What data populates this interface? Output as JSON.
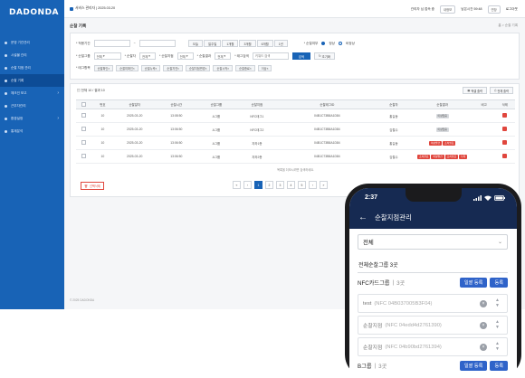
{
  "app": {
    "logo": "DADONDA"
  },
  "sidebar": {
    "items": [
      {
        "label": "운영 기관관리",
        "active": false,
        "chevron": false
      },
      {
        "label": "시설물 관리",
        "active": false,
        "chevron": false
      },
      {
        "label": "순찰 지점 관리",
        "active": false,
        "chevron": false
      },
      {
        "label": "순찰 기록",
        "active": true,
        "chevron": false
      },
      {
        "label": "체크인 보고",
        "active": false,
        "chevron": true
      },
      {
        "label": "근무자관리",
        "active": false,
        "chevron": false
      },
      {
        "label": "환경설정",
        "active": false,
        "chevron": true
      },
      {
        "label": "통계분석",
        "active": false,
        "chevron": false
      }
    ]
  },
  "topbar": {
    "site": "서비스 관리자 | 2025.03.20",
    "user": "관리자 님 접속 중",
    "user_btn": "내정보",
    "time_text": "남은시간 59:48",
    "extend": "연장",
    "logout": "로그아웃"
  },
  "page": {
    "title": "순찰 기록",
    "breadcrumb": "홈 > 순찰 기록"
  },
  "filter": {
    "date_label": "* 적용기간",
    "date_from": "",
    "date_to": "",
    "date_sep": "~",
    "quick_ranges": [
      "오늘",
      "일주일",
      "1개월",
      "3개월",
      "6개월",
      "1년"
    ],
    "radio_label": "* 순찰여부",
    "radio_opts": [
      "정상",
      "비정상"
    ],
    "sel1_label": "* 순찰그룹",
    "sel1": "전체",
    "sel2_label": "* 순찰자",
    "sel2": "전체",
    "sel3_label": "* 순찰지점",
    "sel3": "전체",
    "sel4_label": "* 순찰결과",
    "sel4": "전체",
    "search_label": "* 태그검색",
    "search_placeholder": "키워드 검색",
    "search_btn": "검색",
    "reset_btn": "초기화",
    "tags_label": "* 태그항목",
    "chips": [
      "순찰확인",
      "순찰미확인",
      "순찰누락",
      "순찰지연",
      "순찰지점변경",
      "순찰시작",
      "순찰종료",
      "이상"
    ]
  },
  "table": {
    "count_text": "전체 10 / 결과 10",
    "excel_btn": "엑셀 출력",
    "print_btn": "전체 출력",
    "headers": [
      "",
      "번호",
      "순찰일자",
      "순찰시간",
      "순찰그룹",
      "순찰지점",
      "순찰태그ID",
      "순찰자",
      "순찰결과",
      "비고",
      "삭제"
    ],
    "rows": [
      {
        "no": "10",
        "date": "2025-03-20",
        "time": "13:08:50",
        "group": "A그룹",
        "point": "NFC태그1",
        "tagid": "04B1C73B8A1D84",
        "user": "홍길동",
        "tags": [
          {
            "t": "이상없음",
            "grey": true
          }
        ]
      },
      {
        "no": "10",
        "date": "2025-03-20",
        "time": "13:06:50",
        "group": "A그룹",
        "point": "NFC태그2",
        "tagid": "04B1C73B8A1D84",
        "user": "김철수",
        "tags": [
          {
            "t": "이상없음",
            "grey": true
          }
        ]
      },
      {
        "no": "10",
        "date": "2025-03-20",
        "time": "13:06:50",
        "group": "A그룹",
        "point": "지하1층",
        "tagid": "04B1C73B8A1D84",
        "user": "홍길동",
        "tags": [
          {
            "t": "이상발견",
            "grey": false
          },
          {
            "t": "조치필요",
            "grey": false
          }
        ]
      },
      {
        "no": "10",
        "date": "2025-03-20",
        "time": "13:06:50",
        "group": "A그룹",
        "point": "지하2층",
        "tagid": "04B1C73B8A1D84",
        "user": "김철수",
        "tags": [
          {
            "t": "조치완료",
            "grey": false
          },
          {
            "t": "이상발견",
            "grey": false
          },
          {
            "t": "조치필요",
            "grey": false
          },
          {
            "t": "누락",
            "grey": false
          }
        ]
      }
    ],
    "footnote": "목록을 더보시려면 검색하세요.",
    "bulk_delete": "선택삭제",
    "pages": [
      "«",
      "‹",
      "1",
      "2",
      "3",
      "4",
      "5",
      "›",
      "»"
    ],
    "active_page": "1"
  },
  "footer": {
    "copyright": "© 2025 DADONDA"
  },
  "phone": {
    "time": "2:37",
    "title": "순찰지점관리",
    "select_value": "전체",
    "group_title": "전체순찰그룹 3곳",
    "group1": {
      "name": "NFC카드그룹",
      "count": "3곳",
      "btn1": "일괄 등록",
      "btn2": "등록"
    },
    "items": [
      {
        "name": "test",
        "tag": "(NFC 04B037005B3F04)"
      },
      {
        "name": "순찰지점",
        "tag": "(NFC 04edd4d2761390)"
      },
      {
        "name": "순찰지점",
        "tag": "(NFC 04b90bd2761394)"
      }
    ],
    "group2": {
      "name": "B그룹",
      "count": "3곳",
      "btn1": "일괄 등록",
      "btn2": "등록"
    }
  }
}
